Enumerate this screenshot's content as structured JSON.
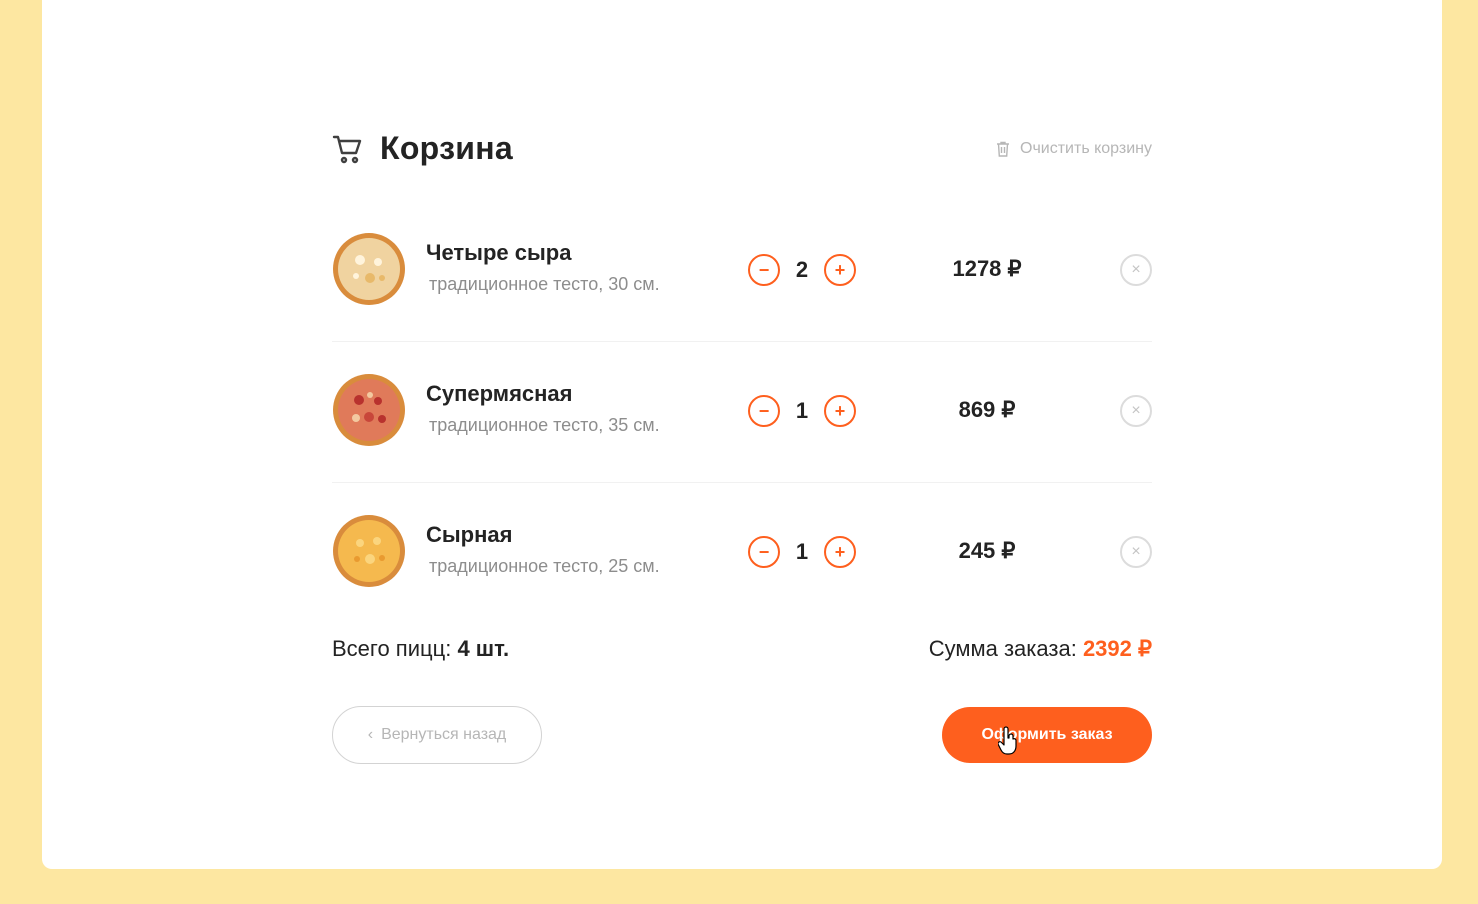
{
  "cart": {
    "title": "Корзина",
    "clear_label": "Очистить корзину",
    "items": [
      {
        "name": "Четыре сыра",
        "desc": "традиционное тесто, 30 см.",
        "count": "2",
        "price": "1278 ₽"
      },
      {
        "name": "Супермясная",
        "desc": "традиционное тесто, 35 см.",
        "count": "1",
        "price": "869 ₽"
      },
      {
        "name": "Сырная",
        "desc": "традиционное тесто, 25 см.",
        "count": "1",
        "price": "245 ₽"
      }
    ],
    "total_count_label": "Всего пицц:",
    "total_count": "4 шт.",
    "total_sum_label": "Сумма заказа:",
    "total_sum": "2392 ₽",
    "back_label": "Вернуться назад",
    "pay_label": "Оформить заказ",
    "minus_icon": "−",
    "plus_icon": "+",
    "remove_icon": "×",
    "back_chevron": "‹"
  },
  "colors": {
    "accent": "#fe5f1e",
    "background": "#fde7a1",
    "panel": "#ffffff"
  }
}
